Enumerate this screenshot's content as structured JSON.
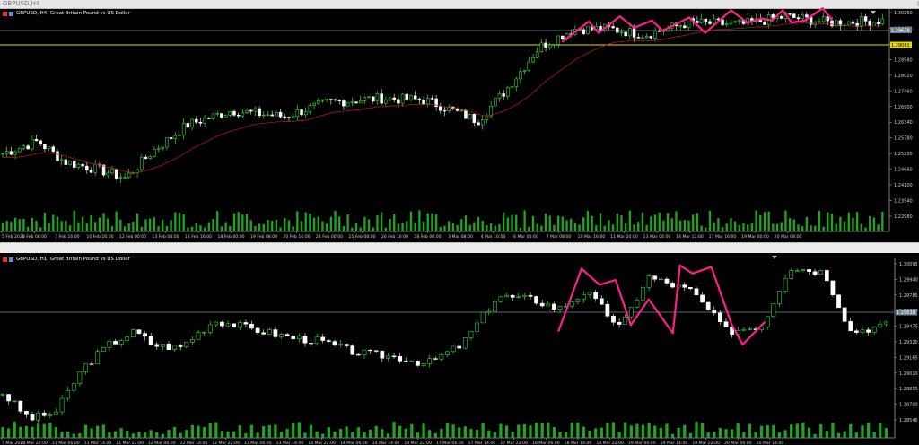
{
  "window": {
    "title": "GBPUSD,H4",
    "controls": [
      "–",
      "▢",
      "✕"
    ]
  },
  "top_chart": {
    "symbol_icon": "chart-flag-icon",
    "label": "GBPUSD, H4:  Great Britain Pound vs US Dollar",
    "prices": [
      "1.30260",
      "1.29638",
      "1.29081",
      "1.28580",
      "1.28020",
      "1.27460",
      "1.26900",
      "1.26340",
      "1.25780",
      "1.25220",
      "1.24660",
      "1.24100",
      "1.23540",
      "1.22980"
    ],
    "bid_tag": "1.29638",
    "line_tag": "1.29081",
    "times": [
      "5 Feb 2025",
      "6 Feb 08:00",
      "7 Feb 16:00",
      "10 Feb 16:00",
      "12 Feb 00:00",
      "13 Feb 08:00",
      "14 Feb 16:00",
      "18 Feb 00:00",
      "19 Feb 08:00",
      "20 Feb 16:00",
      "24 Feb 00:00",
      "25 Feb 08:00",
      "26 Feb 16:00",
      "28 Feb 00:00",
      "3 Mar 08:00",
      "4 Mar 16:00",
      "6 Mar 00:00",
      "7 Mar 08:00",
      "10 Mar 16:00",
      "11 Mar 20:00",
      "13 Mar 04:00",
      "14 Mar 12:00",
      "17 Mar 16:00",
      "19 Mar 00:00",
      "20 Mar 08:00"
    ]
  },
  "bottom_chart": {
    "symbol_icon": "chart-flag-icon",
    "label": "GBPUSD, H1:  Great Britain Pound vs US Dollar",
    "prices": [
      "1.30095",
      "1.29940",
      "1.29785",
      "1.29630",
      "1.29475",
      "1.29320",
      "1.29165",
      "1.29010",
      "1.28855",
      "1.28700",
      "1.28545"
    ],
    "bid_tag": "1.29638",
    "times": [
      "7 Mar 2025",
      "10 Mar 22:00",
      "11 Mar 06:00",
      "11 Mar 14:00",
      "11 Mar 22:00",
      "12 Mar 06:00",
      "12 Mar 14:00",
      "12 Mar 22:00",
      "13 Mar 06:00",
      "13 Mar 14:00",
      "13 Mar 22:00",
      "14 Mar 06:00",
      "14 Mar 14:00",
      "14 Mar 22:00",
      "17 Mar 06:00",
      "17 Mar 14:00",
      "17 Mar 22:00",
      "18 Mar 06:00",
      "18 Mar 14:00",
      "18 Mar 22:00",
      "19 Mar 06:00",
      "19 Mar 14:00",
      "19 Mar 22:00",
      "20 Mar 06:00",
      "20 Mar 14:00"
    ]
  },
  "colors": {
    "bull": "#33ff33",
    "bear": "#ffffff",
    "ma": "#b01818",
    "zigzag": "#ff1f8a",
    "hline": "#e6d800",
    "bidline": "#7a8a99",
    "volume": "#1fa51f",
    "axis_text": "#cfcfcf"
  }
}
